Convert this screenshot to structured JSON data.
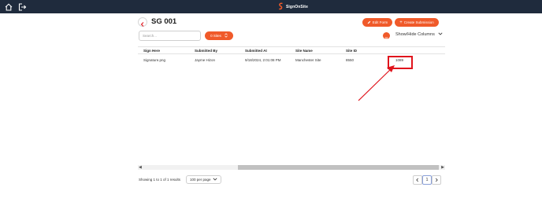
{
  "app": {
    "brand": "SignOnSite",
    "accent_color": "#f05a2a",
    "topbar_color": "#1f2b3d"
  },
  "header": {
    "title": "SG 001",
    "edit_form_label": "Edit Form",
    "create_submission_label": "Create Submission"
  },
  "filters": {
    "search_placeholder": "Search...",
    "sites_label": "0 Sites",
    "show_hide_label": "Show/Hide Columns"
  },
  "table": {
    "columns": [
      "Sign Here",
      "Submitted By",
      "Submitted At",
      "Site Name",
      "Site ID",
      ""
    ],
    "rows": [
      [
        "Signature.png",
        "Jayme Hizon",
        "9/18/2024, 2:01:08 PM",
        "Manchester Site",
        "8550",
        "1089"
      ]
    ]
  },
  "footer": {
    "results_text": "Showing 1 to 1 of 1 results",
    "per_page_label": "100 per page",
    "current_page": "1"
  },
  "annotation": {
    "color": "#e0141c"
  }
}
